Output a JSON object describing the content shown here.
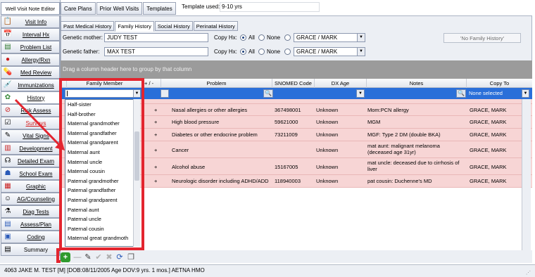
{
  "sidebar": {
    "title": "Well Visit Note Editor",
    "items": [
      {
        "label": "Visit Info",
        "icon": "clipboard-icon"
      },
      {
        "label": "Interval Hx",
        "icon": "calendar-icon"
      },
      {
        "label": "Problem List",
        "icon": "list-icon"
      },
      {
        "label": "Allergy/Rxn",
        "icon": "allergy-icon"
      },
      {
        "label": "Med Review",
        "icon": "pill-icon"
      },
      {
        "label": "Immunizations",
        "icon": "syringe-icon"
      },
      {
        "label": "History",
        "icon": "family-tree-icon"
      },
      {
        "label": "Risk Assess",
        "icon": "no-entry-icon"
      },
      {
        "label": "Surveys",
        "icon": "checklist-icon"
      },
      {
        "label": "Vital Signs",
        "icon": "pen-icon"
      },
      {
        "label": "Development",
        "icon": "chart-icon"
      },
      {
        "label": "Detailed Exam",
        "icon": "stethoscope-icon"
      },
      {
        "label": "School Exam",
        "icon": "school-icon"
      },
      {
        "label": "Graphic",
        "icon": "graphic-icon"
      },
      {
        "label": "AG/Counseling",
        "icon": "counseling-icon"
      },
      {
        "label": "Diag Tests",
        "icon": "test-icon"
      },
      {
        "label": "Assess/Plan",
        "icon": "plan-icon"
      },
      {
        "label": "Coding",
        "icon": "coding-icon"
      },
      {
        "label": "Summary",
        "icon": "summary-icon"
      }
    ]
  },
  "top_tabs": [
    "Care Plans",
    "Prior Well Visits",
    "Templates"
  ],
  "template": {
    "label": "Template used:",
    "value": "9-10 yrs"
  },
  "sub_tabs": [
    "Past Medical History",
    "Family History",
    "Social History",
    "Perinatal History"
  ],
  "mother": {
    "label": "Genetic mother:",
    "value": "JUDY TEST",
    "copy_label": "Copy Hx:",
    "all": "All",
    "none": "None",
    "copy_value": "GRACE / MARK"
  },
  "father": {
    "label": "Genetic father:",
    "value": "MAX TEST",
    "copy_label": "Copy Hx:",
    "all": "All",
    "none": "None",
    "copy_value": "GRACE / MARK"
  },
  "no_family_button": "'No Family History'",
  "group_hint": "Drag a column header here to group by that column",
  "columns": [
    "Family Member",
    "+ / -",
    "Problem",
    "SNOMED Code",
    "DX Age",
    "Notes",
    "Copy To"
  ],
  "filter_copy_to": "None selected",
  "rows": [
    {
      "sign": "+",
      "problem": "Nasal allergies or other allergies",
      "snomed": "367498001",
      "age": "Unknown",
      "notes": "Mom:PCN allergy",
      "copy": "GRACE, MARK"
    },
    {
      "sign": "+",
      "problem": "High blood pressure",
      "snomed": "59621000",
      "age": "Unknown",
      "notes": "MGM",
      "copy": "GRACE, MARK"
    },
    {
      "sign": "+",
      "problem": "Diabetes or other endocrine problem",
      "snomed": "73211009",
      "age": "Unknown",
      "notes": "MGF: Type 2 DM (double BKA)",
      "copy": "GRACE, MARK"
    },
    {
      "sign": "+",
      "problem": "Cancer",
      "snomed": "",
      "age": "Unknown",
      "notes": "mat aunt: malignant melanoma (deceased age 31yr)",
      "copy": "GRACE, MARK"
    },
    {
      "sign": "+",
      "problem": "Alcohol abuse",
      "snomed": "15167005",
      "age": "Unknown",
      "notes": "mat uncle: deceased due to cirrhosis of liver",
      "copy": "GRACE, MARK"
    },
    {
      "sign": "+",
      "problem": "Neurologic disorder including ADHD/ADD",
      "snomed": "118940003",
      "age": "Unknown",
      "notes": "pat cousin: Duchenne's MD",
      "copy": "GRACE, MARK"
    }
  ],
  "dropdown_items": [
    "Half-sister",
    "Half-brother",
    "Maternal grandmother",
    "Maternal grandfather",
    "Maternal grandparent",
    "Maternal aunt",
    "Maternal uncle",
    "Maternal cousin",
    "Paternal grandmother",
    "Paternal grandfather",
    "Paternal grandparent",
    "Paternal aunt",
    "Paternal uncle",
    "Paternal cousin",
    "Maternal great grandmoth"
  ],
  "status": "4063 JAKE M. TEST [M] [DOB:08/11/2005  Age DOV:9 yrs. 1 mos.] AETNA HMO",
  "colors": {
    "row_bg": "#f7d5d5",
    "filter_bg": "#2a6fd9",
    "highlight": "#e3252f"
  }
}
